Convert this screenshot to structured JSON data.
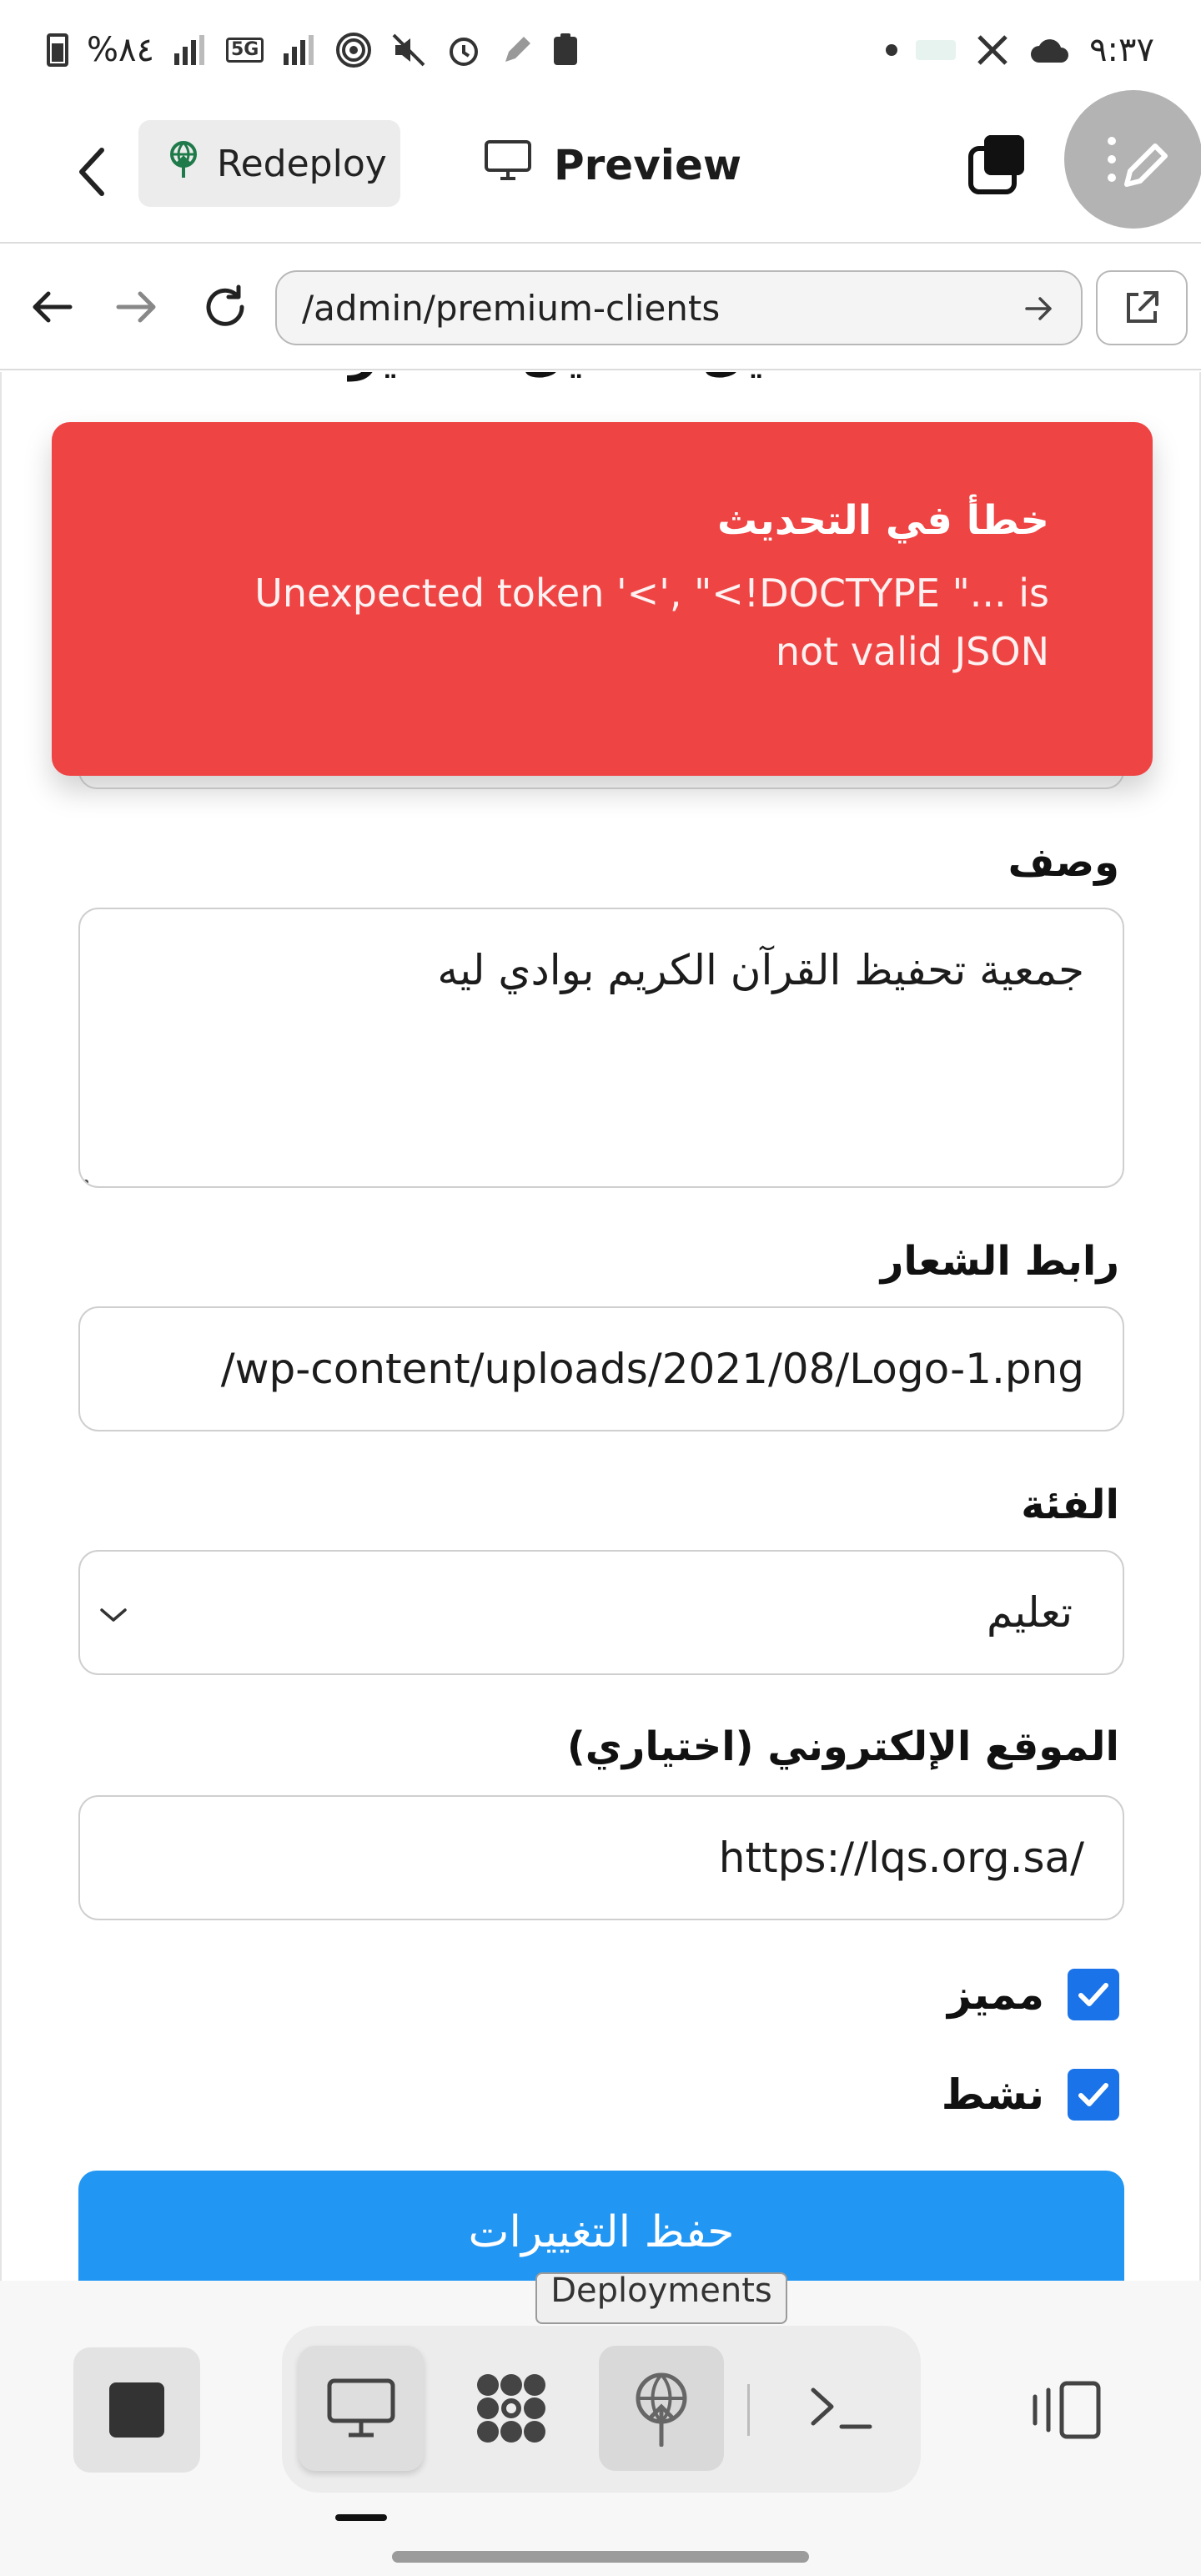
{
  "status_bar": {
    "time": "٩:٣٧",
    "battery": "%٨٤",
    "network": "5G"
  },
  "toolbar": {
    "redeploy_label": "Redeploy",
    "preview_label": "Preview"
  },
  "browser": {
    "url": "/admin/premium-clients"
  },
  "page": {
    "title": "تعديل العميل المميز"
  },
  "toast": {
    "title": "خطأ في التحديث",
    "message": "Unexpected token '<', \"<!DOCTYPE \"... is not valid JSON",
    "color": "#ef4444"
  },
  "form": {
    "description": {
      "label": "وصف",
      "value": "جمعية تحفيظ القرآن الكريم بوادي ليه"
    },
    "logo_url": {
      "label": "رابط الشعار",
      "value": "/wp-content/uploads/2021/08/Logo-1.png"
    },
    "category": {
      "label": "الفئة",
      "selected": "تعليم"
    },
    "website": {
      "label": "الموقع الإلكتروني (اختياري)",
      "value": "https://lqs.org.sa/"
    },
    "featured": {
      "label": "مميز",
      "checked": true
    },
    "active": {
      "label": "نشط",
      "checked": true
    },
    "save_label": "حفظ التغييرات",
    "accent": "#2196f3",
    "checkbox_color": "#1a73e8"
  },
  "dock": {
    "tooltip": "Deployments",
    "items": [
      {
        "icon": "stop-icon"
      },
      {
        "icon": "desktop-icon"
      },
      {
        "icon": "apps-icon"
      },
      {
        "icon": "deployments-icon"
      },
      {
        "icon": "terminal-icon"
      },
      {
        "icon": "sidebar-toggle-icon"
      }
    ]
  }
}
